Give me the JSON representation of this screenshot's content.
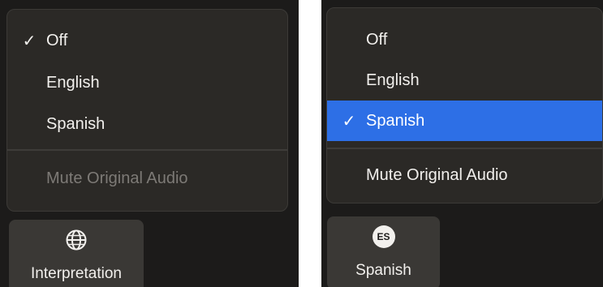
{
  "left_panel": {
    "menu": {
      "items": [
        {
          "label": "Off",
          "checked": true
        },
        {
          "label": "English",
          "checked": false
        },
        {
          "label": "Spanish",
          "checked": false
        }
      ],
      "mute_label": "Mute Original Audio",
      "mute_enabled": false
    },
    "button": {
      "label": "Interpretation",
      "icon": "globe-icon"
    }
  },
  "right_panel": {
    "menu": {
      "items": [
        {
          "label": "Off",
          "checked": false
        },
        {
          "label": "English",
          "checked": false
        },
        {
          "label": "Spanish",
          "checked": true
        }
      ],
      "mute_label": "Mute Original Audio",
      "mute_enabled": true
    },
    "button": {
      "label": "Spanish",
      "badge": "ES"
    }
  },
  "check_glyph": "✓",
  "colors": {
    "background": "#1c1b1a",
    "menu": "#2b2926",
    "selected": "#2d6fe6",
    "text": "#f2f0ed",
    "disabled_text": "#7d7a76",
    "button": "#3a3835"
  }
}
